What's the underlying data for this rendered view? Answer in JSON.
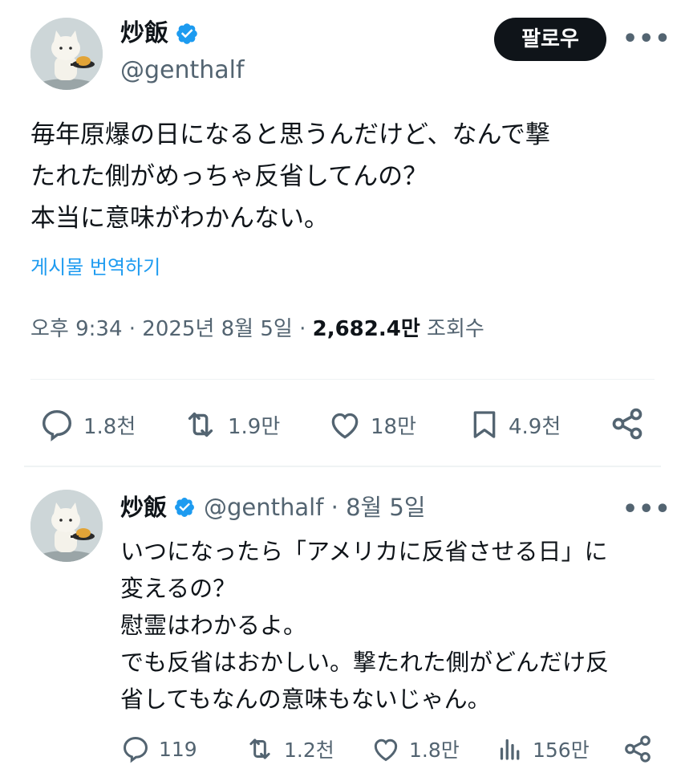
{
  "tweet": {
    "author": {
      "display_name": "炒飯",
      "handle": "@genthalf",
      "verified": true
    },
    "follow_label": "팔로우",
    "more_label": "•••",
    "text_lines": [
      "毎年原爆の日になると思うんだけど、なんで撃",
      "たれた側がめっちゃ反省してんの？",
      "本当に意味がわかんない。"
    ],
    "translate_label": "게시물 번역하기",
    "meta": {
      "time_date": "오후 9:34 · 2025년 8월 5일 · ",
      "views": "2,682.4만",
      "views_label": " 조회수"
    },
    "actions": {
      "replies": "1.8천",
      "retweets": "1.9만",
      "likes": "18만",
      "bookmarks": "4.9천"
    }
  },
  "reply": {
    "author": {
      "display_name": "炒飯",
      "handle_date": "@genthalf · 8월 5일",
      "verified": true
    },
    "more_label": "•••",
    "text_lines": [
      "いつになったら「アメリカに反省させる日」に",
      "変えるの？",
      "慰霊はわかるよ。",
      "でも反省はおかしい。撃たれた側がどんだけ反",
      "省してもなんの意味もないじゃん。"
    ],
    "actions": {
      "replies": "119",
      "retweets": "1.2천",
      "likes": "1.8만",
      "views": "156만"
    }
  },
  "colors": {
    "accent": "#1d9bf0",
    "text": "#0f1419",
    "muted": "#536471",
    "divider": "#eff3f4"
  },
  "icons": [
    "verified-badge-icon",
    "reply-icon",
    "retweet-icon",
    "like-icon",
    "bookmark-icon",
    "share-icon",
    "views-icon",
    "more-icon"
  ]
}
